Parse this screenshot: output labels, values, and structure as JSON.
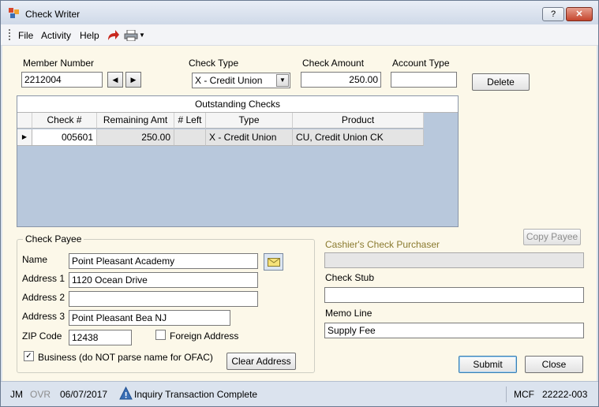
{
  "window": {
    "title": "Check Writer",
    "help_label": "?",
    "close_label": "✕"
  },
  "menu": {
    "items": [
      "File",
      "Activity",
      "Help"
    ],
    "undo_icon": "undo-arrow-icon",
    "print_icon": "printer-icon"
  },
  "member": {
    "label": "Member Number",
    "value": "2212004",
    "prev": "◀",
    "next": "▶"
  },
  "check_type": {
    "label": "Check Type",
    "value": "X - Credit Union",
    "arrow": "▼"
  },
  "check_amount": {
    "label": "Check Amount",
    "value": "250.00"
  },
  "account_type": {
    "label": "Account Type",
    "value": ""
  },
  "delete_label": "Delete",
  "outstanding": {
    "caption": "Outstanding Checks",
    "columns": [
      "Check #",
      "Remaining Amt",
      "# Left",
      "Type",
      "Product"
    ],
    "rows": [
      {
        "marker": "▶",
        "check_no": "005601",
        "remaining": "250.00",
        "left": "",
        "type": "X - Credit Union",
        "product": "CU, Credit Union CK"
      }
    ]
  },
  "payee": {
    "title": "Check Payee",
    "name_label": "Name",
    "name": "Point Pleasant Academy",
    "addr1_label": "Address 1",
    "addr1": "1120 Ocean Drive",
    "addr2_label": "Address 2",
    "addr2": "",
    "addr3_label": "Address 3",
    "addr3": "Point Pleasant Bea NJ",
    "zip_label": "ZIP Code",
    "zip": "12438",
    "foreign_label": "Foreign Address",
    "foreign_checked": false,
    "business_label": "Business (do NOT parse name for OFAC)",
    "business_checked": true,
    "business_mark": "✓",
    "clear_label": "Clear Address",
    "envelope_icon": "envelope-icon"
  },
  "cashier": {
    "copy_label": "Copy Payee",
    "purchaser_label": "Cashier's Check Purchaser",
    "purchaser_value": ""
  },
  "stub": {
    "label": "Check Stub",
    "value": ""
  },
  "memo": {
    "label": "Memo Line",
    "value": "Supply Fee"
  },
  "submit_label": "Submit",
  "close_label": "Close",
  "status": {
    "user": "JM",
    "mode": "OVR",
    "date": "06/07/2017",
    "message": "Inquiry Transaction Complete",
    "code": "MCF",
    "terminal": "22222-003"
  },
  "colors": {
    "accent": "#3c7fb1",
    "purchaser_label": "#8a7a2e",
    "form_bg": "#fcf8e9"
  }
}
